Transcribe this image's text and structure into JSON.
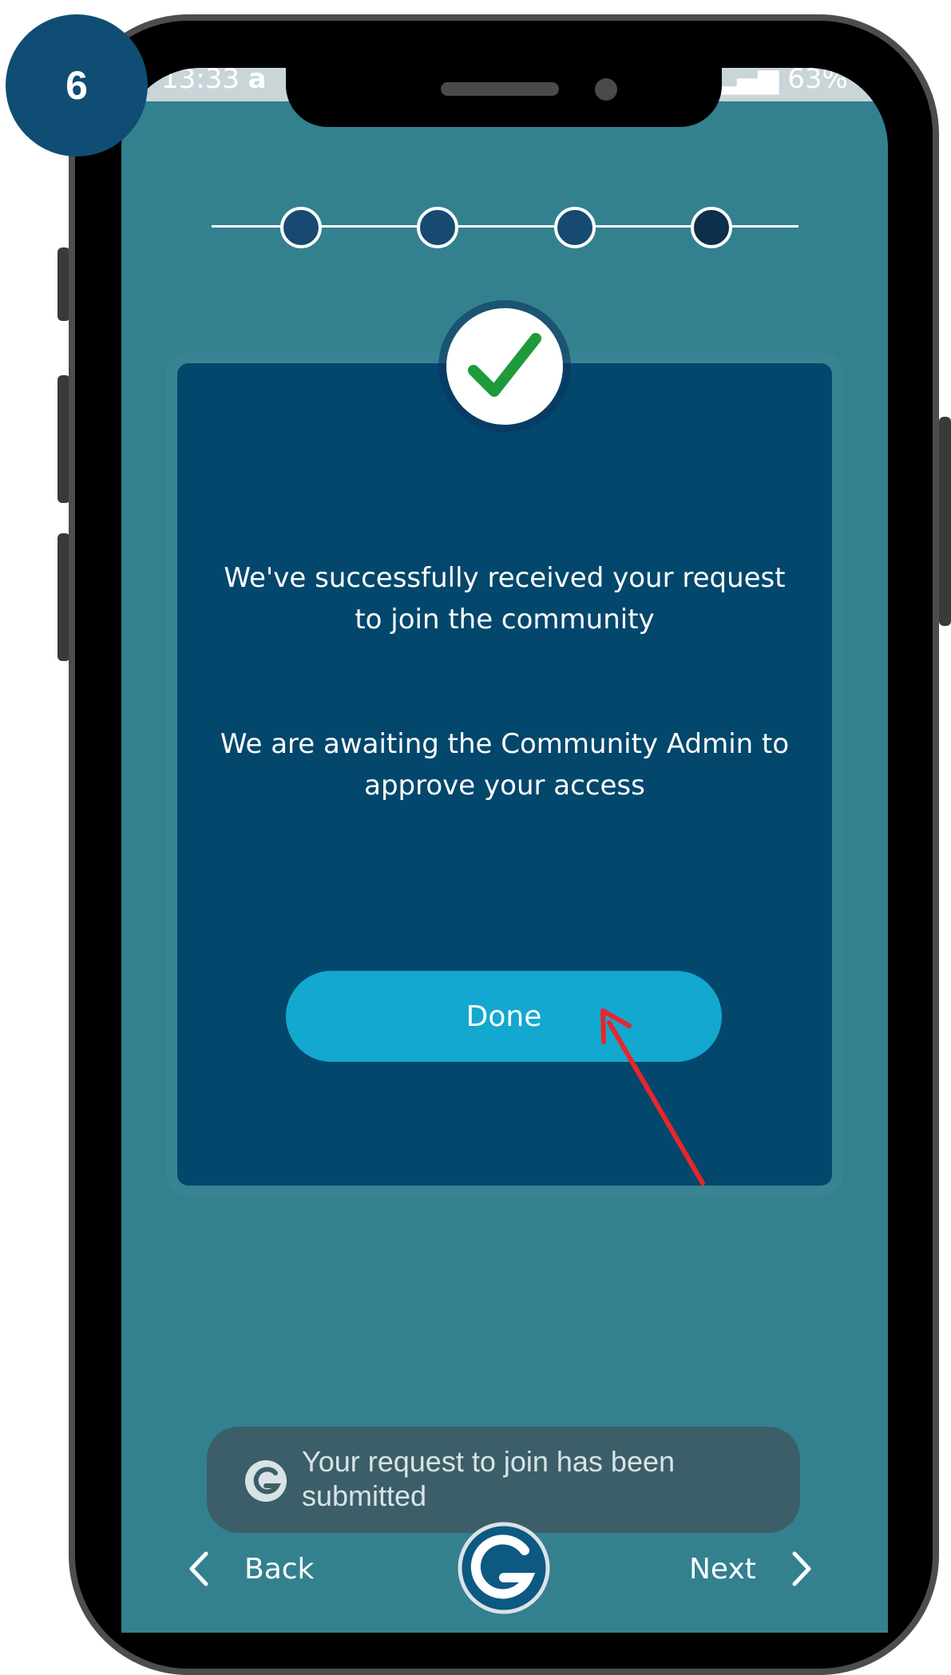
{
  "step_number": "6",
  "status_bar": {
    "time": "13:33",
    "carrier_glyph": "a",
    "battery": "63%"
  },
  "stepper": {
    "total_steps": 4,
    "current_step": 4
  },
  "success_card": {
    "icon": "checkmark-icon",
    "message_line1": "We've successfully received your request",
    "message_line2": "to join the community",
    "message_line3": "We are awaiting the Community Admin to",
    "message_line4": "approve your access",
    "done_label": "Done"
  },
  "toast": {
    "icon": "app-logo-icon",
    "line1": "Your request to join has been",
    "line2": "submitted"
  },
  "bottom_nav": {
    "back_label": "Back",
    "next_label": "Next",
    "center_icon": "app-logo-icon"
  },
  "colors": {
    "screen_bg": "#33808f",
    "card_bg": "#03476c",
    "accent_button": "#13a8cf",
    "step_badge": "#0f4d74",
    "checkmark": "#1e9a3a",
    "annotation_arrow": "#e8262b"
  }
}
